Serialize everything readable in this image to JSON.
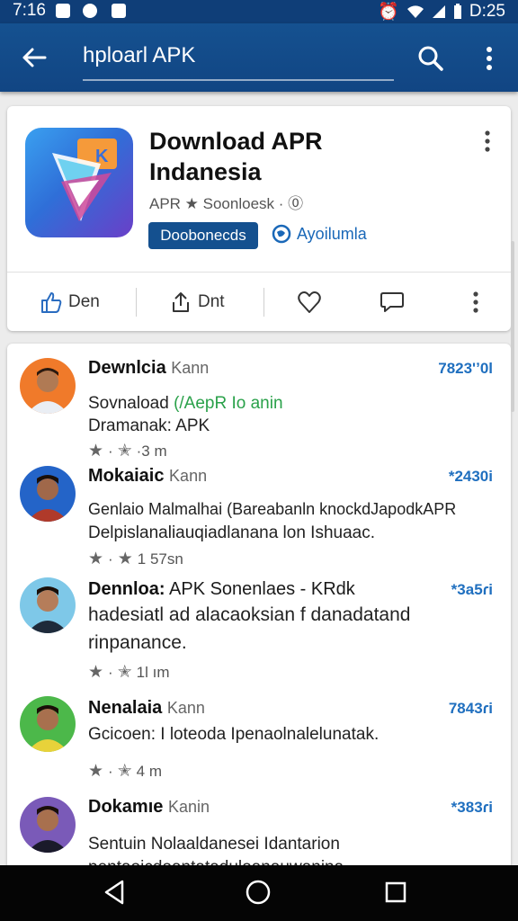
{
  "status_bar": {
    "time_left": "7:16",
    "time_right": "D:25"
  },
  "app_bar": {
    "query": "hploarl APK",
    "back_icon": "back-arrow-icon",
    "search_icon": "search-icon",
    "menu_icon": "more-vert-icon"
  },
  "app_card": {
    "title_line1": "Download APR",
    "title_line2": "Indanesia",
    "subtitle": "APR ★ Soonloesk · ⓪",
    "download_label": "Doobonecds",
    "popular_label": "Ayoilumla",
    "actions": [
      {
        "icon": "thumbs-up-icon",
        "label": "Den"
      },
      {
        "icon": "share-icon",
        "label": "Dnt"
      },
      {
        "icon": "heart-icon",
        "label": ""
      },
      {
        "icon": "comment-icon",
        "label": ""
      },
      {
        "icon": "more-vert-icon",
        "label": ""
      }
    ]
  },
  "list": {
    "items": [
      {
        "name": "Dewnlcia",
        "handle": "Kann",
        "count": "7823'ʼ0l",
        "line1_prefix": "Sovnaload ",
        "line1_green": "(/AepR Io anin",
        "line2": "Dramanak: APK",
        "rating": "·3 m"
      },
      {
        "name": "Mokaiaic",
        "handle": "Kann",
        "count": "*2430i",
        "line1": "Genlaio Malmalhai (Bareabanln knockdJapodkAPR",
        "line2": "Delpislanaliauqiadlanana lon Ishuaac.",
        "rating": "1 57sn"
      },
      {
        "name": "Dennloa:",
        "handle": "APK Sonenlaes - KRdk",
        "count": "*3a5ɾi",
        "line1": "hadesiatl ad alacaoksian f danadatand",
        "line2": "rinpanance.",
        "rating": "1l ım"
      },
      {
        "name": "Nenalaia",
        "handle": "Kann",
        "count": "7843ɾi",
        "line1": "Gcicoen: I loteoda Ipenaolnalelunatak.",
        "rating": "4 m"
      },
      {
        "name": "Dokamıe",
        "handle": "Kanin",
        "count": "*383ɾi",
        "line1": "Sentuin Nolaaldanesei Idantarion",
        "line2": "pentaoicdoantataduloanauwanina"
      }
    ]
  },
  "colors": {
    "primary": "#14508f",
    "accent_green": "#2aa14a",
    "count_blue": "#1f6fbf"
  }
}
